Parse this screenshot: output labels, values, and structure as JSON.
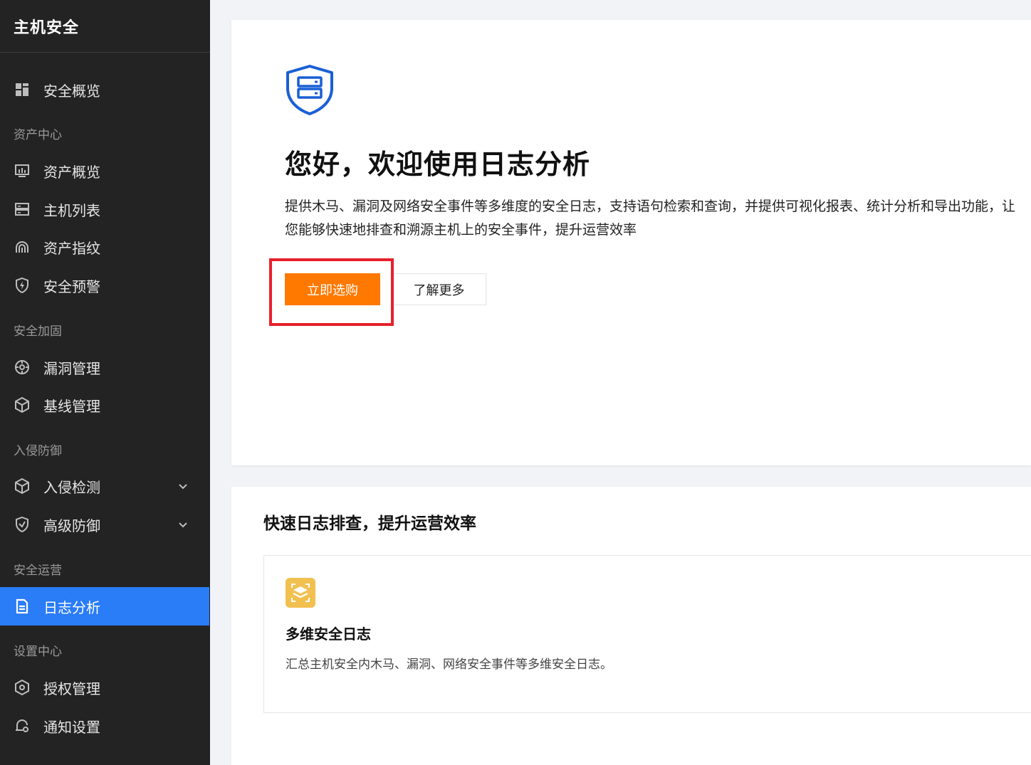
{
  "sidebar": {
    "title": "主机安全",
    "items": [
      {
        "label": "安全概览"
      },
      {
        "section": "资产中心"
      },
      {
        "label": "资产概览"
      },
      {
        "label": "主机列表"
      },
      {
        "label": "资产指纹"
      },
      {
        "label": "安全预警"
      },
      {
        "section": "安全加固"
      },
      {
        "label": "漏洞管理"
      },
      {
        "label": "基线管理"
      },
      {
        "section": "入侵防御"
      },
      {
        "label": "入侵检测"
      },
      {
        "label": "高级防御"
      },
      {
        "section": "安全运营"
      },
      {
        "label": "日志分析"
      },
      {
        "section": "设置中心"
      },
      {
        "label": "授权管理"
      },
      {
        "label": "通知设置"
      }
    ]
  },
  "hero": {
    "title": "您好，欢迎使用日志分析",
    "description": "提供木马、漏洞及网络安全事件等多维度的安全日志，支持语句检索和查询，并提供可视化报表、统计分析和导出功能，让您能够快速地排查和溯源主机上的安全事件，提升运营效率",
    "buy_label": "立即选购",
    "more_label": "了解更多"
  },
  "features": {
    "heading": "快速日志排查，提升运营效率",
    "items": [
      {
        "title": "多维安全日志",
        "desc": "汇总主机安全内木马、漏洞、网络安全事件等多维安全日志。"
      }
    ]
  },
  "colors": {
    "sidebar_bg": "#232323",
    "active_bg": "#2a7cf7",
    "primary_button": "#ff7800",
    "highlight": "#e8202a",
    "feature_icon": "#f2c04f",
    "brand_blue": "#1a5fd6"
  }
}
